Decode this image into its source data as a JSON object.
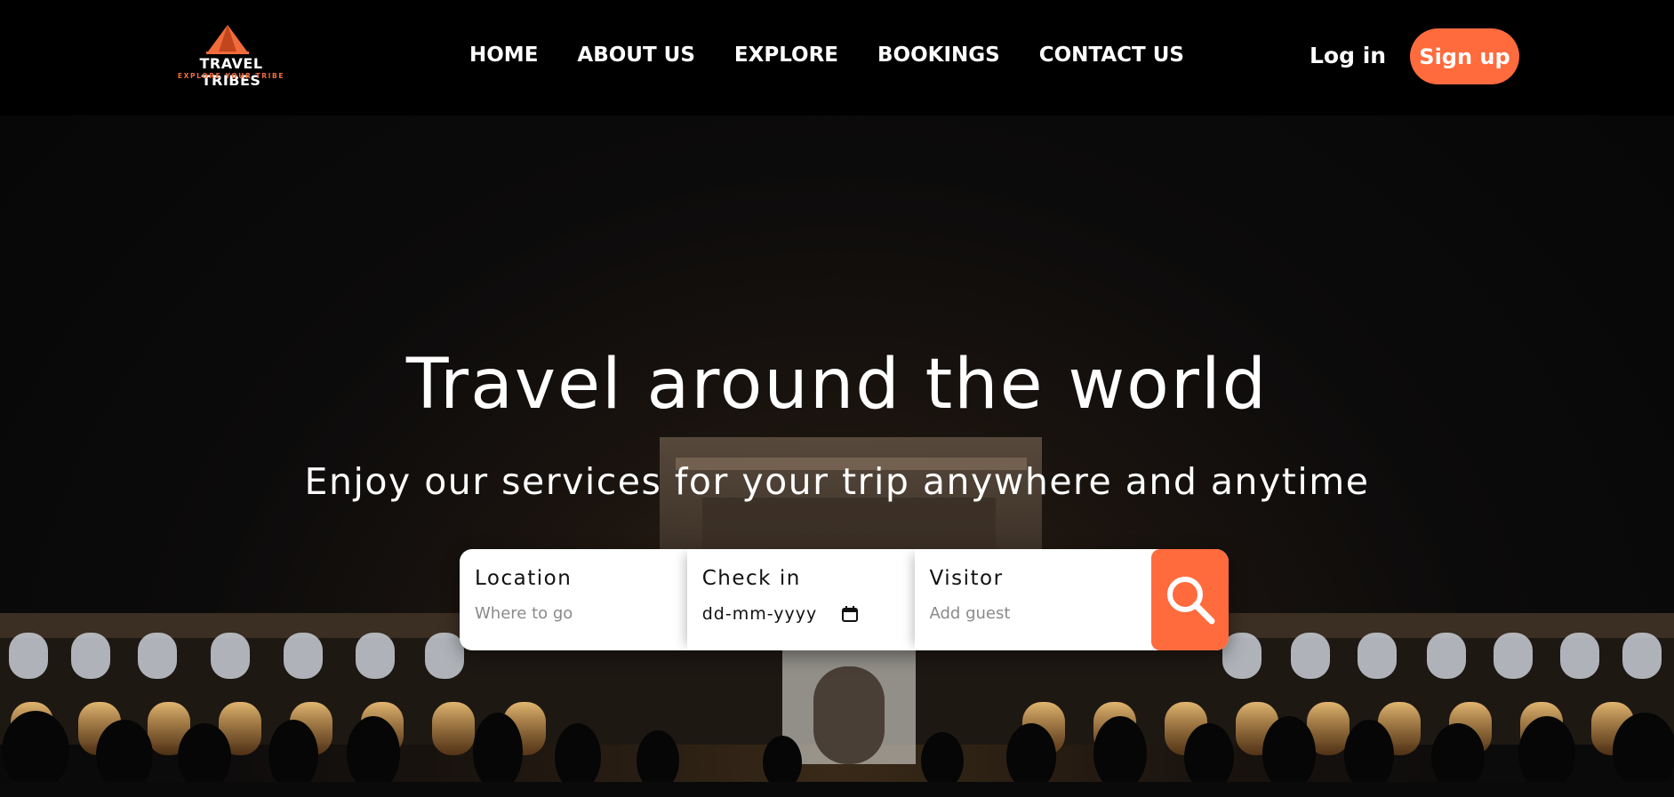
{
  "brand": {
    "name": "TRAVEL TRIBES",
    "tagline": "EXPLORE YOUR TRIBE",
    "logo_icon": "tent-icon",
    "accent_color": "#ff6b3d"
  },
  "nav": {
    "links": [
      {
        "label": "HOME"
      },
      {
        "label": "ABOUT US"
      },
      {
        "label": "EXPLORE"
      },
      {
        "label": "BOOKINGS"
      },
      {
        "label": "CONTACT US"
      }
    ],
    "login_label": "Log in",
    "signup_label": "Sign up"
  },
  "hero": {
    "title": "Travel around the world",
    "subtitle": "Enjoy our services for your trip anywhere and anytime"
  },
  "search": {
    "location": {
      "label": "Location",
      "placeholder": "Where to go"
    },
    "checkin": {
      "label": "Check in",
      "value": "dd-mm-yyyy",
      "icon": "calendar-icon"
    },
    "visitor": {
      "label": "Visitor",
      "placeholder": "Add guest"
    },
    "button_icon": "search-icon"
  }
}
